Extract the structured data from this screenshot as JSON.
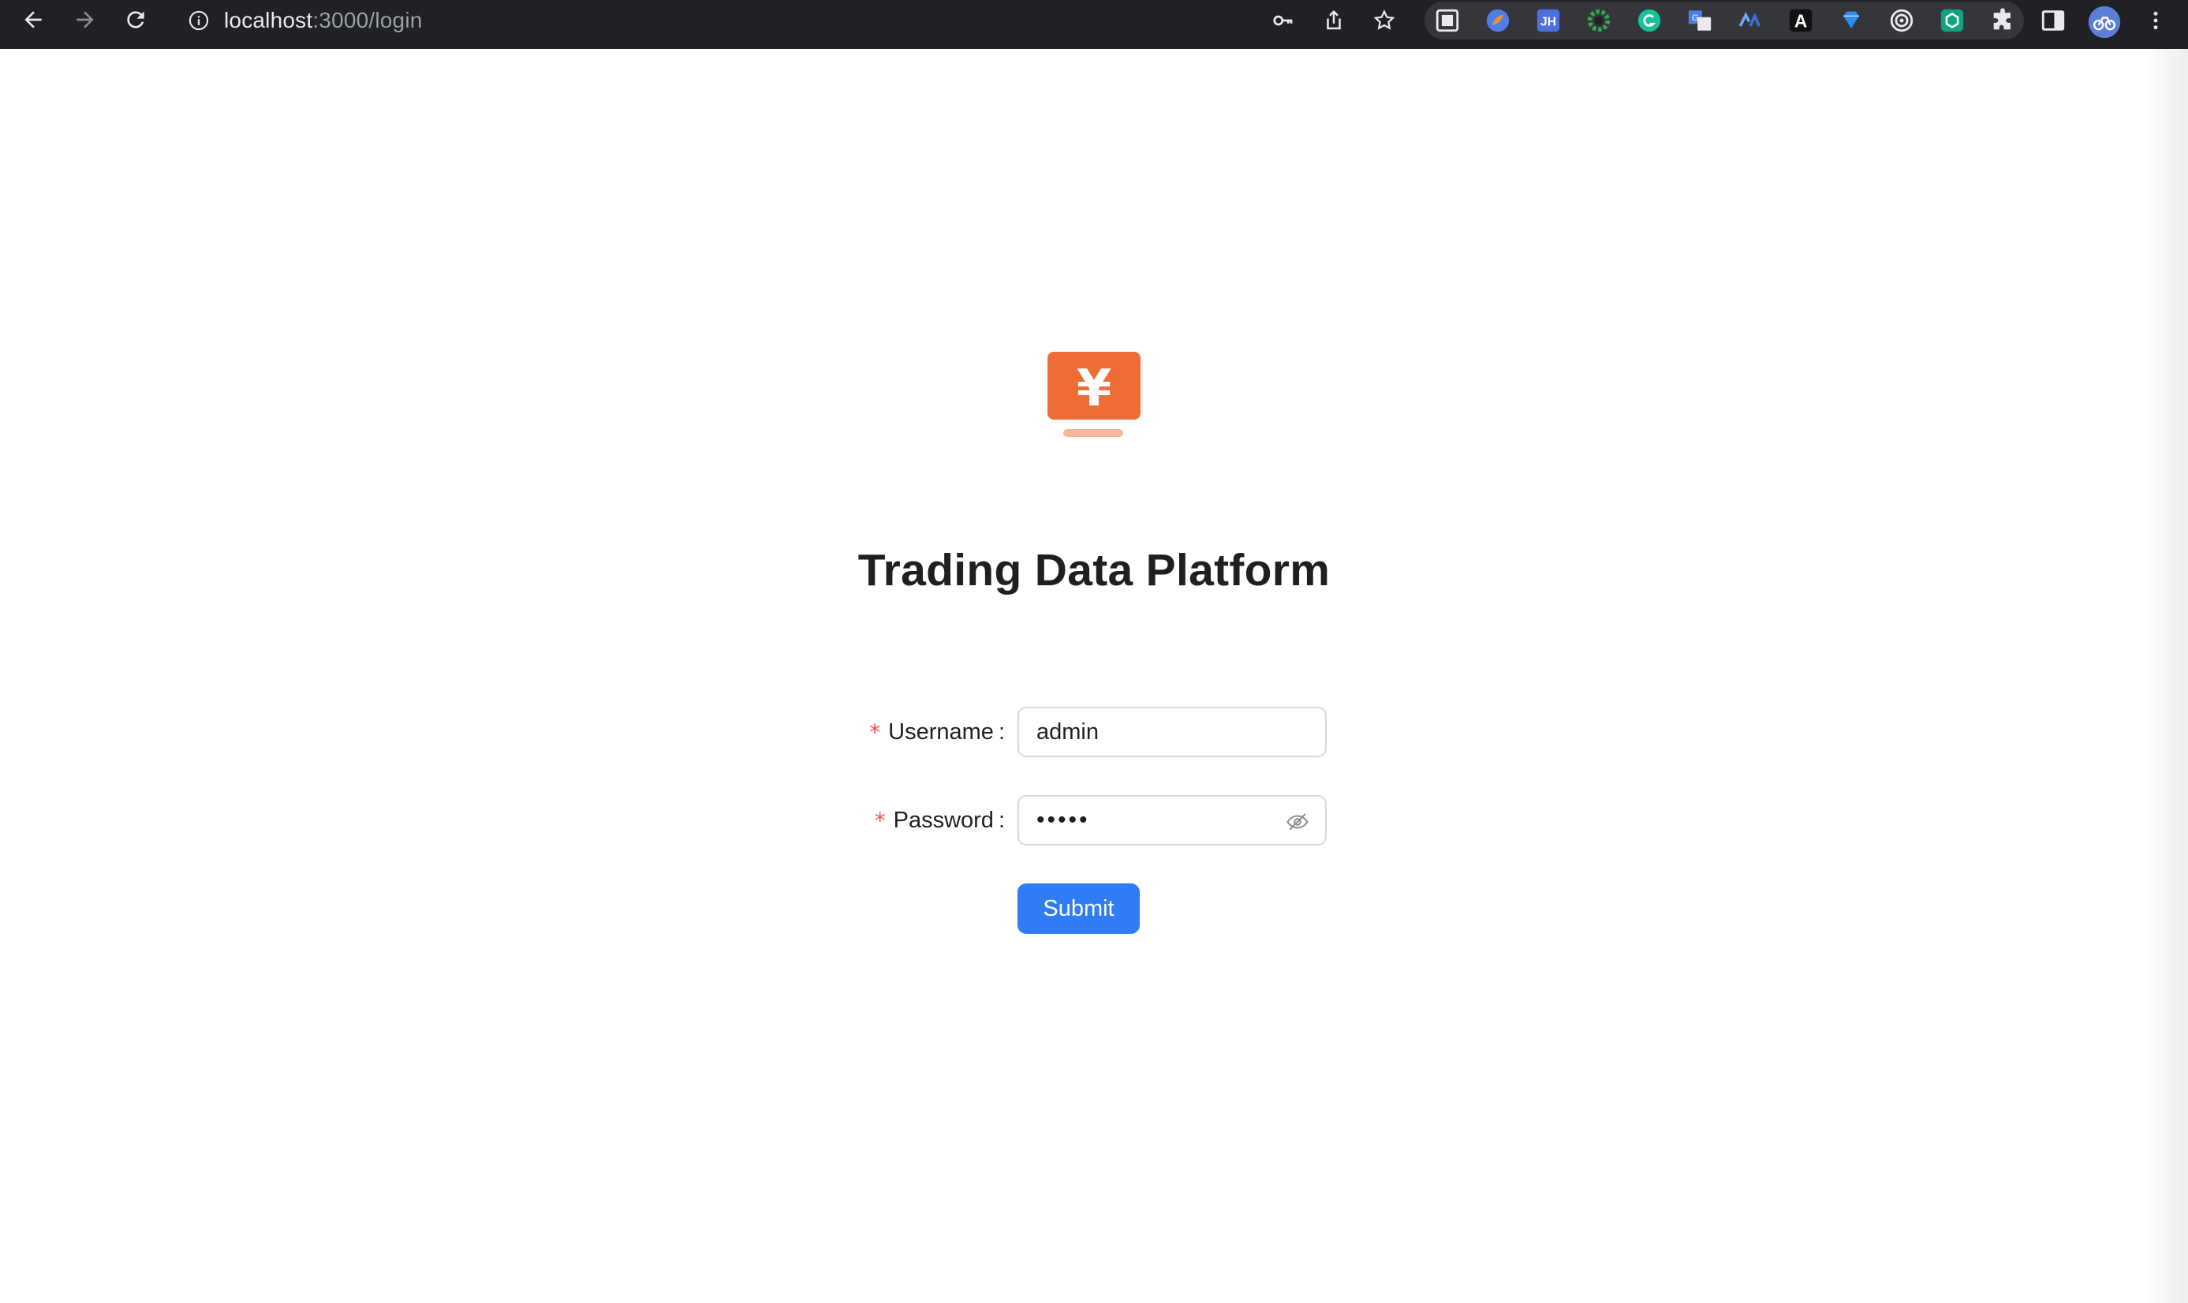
{
  "browser": {
    "url_host": "localhost",
    "url_path": ":3000/login",
    "extension_label_jh": "JH",
    "extension_label_a": "A"
  },
  "page": {
    "title": "Trading Data Platform",
    "logo_glyph": "¥",
    "logo_color": "#ee6c35"
  },
  "form": {
    "username_label": "Username",
    "username_value": "admin",
    "password_label": "Password",
    "password_mask": "•••••",
    "required_mark": "*",
    "colon": ":",
    "submit_label": "Submit"
  },
  "colors": {
    "accent": "#2f7cf6",
    "required": "#ff4d4f",
    "chrome": "#202124"
  }
}
